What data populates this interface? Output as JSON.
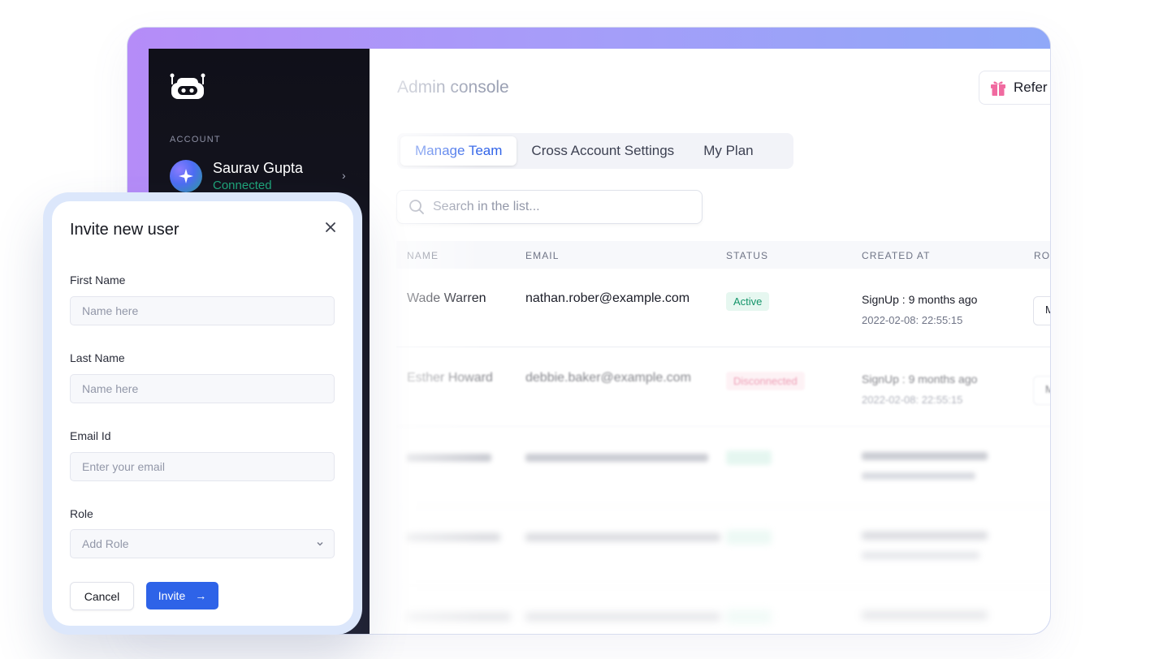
{
  "sidebar": {
    "account_label": "ACCOUNT",
    "user_name": "Saurav Gupta",
    "user_status": "Connected",
    "chevron": "›"
  },
  "header": {
    "title": "Admin console",
    "refer_label": "Refer"
  },
  "tabs": [
    {
      "label": "Manage Team",
      "active": true
    },
    {
      "label": "Cross Account Settings",
      "active": false
    },
    {
      "label": "My Plan",
      "active": false
    }
  ],
  "search": {
    "placeholder": "Search in the list..."
  },
  "table": {
    "columns": [
      "NAME",
      "EMAIL",
      "STATUS",
      "CREATED AT",
      "RO"
    ],
    "rows": [
      {
        "name": "Wade Warren",
        "email": "nathan.rober@example.com",
        "status": "Active",
        "created": "SignUp : 9 months ago",
        "date": "2022-02-08: 22:55:15",
        "role": "M"
      },
      {
        "name": "Esther Howard",
        "email": "debbie.baker@example.com",
        "status": "Disconnected",
        "created": "SignUp : 9 months ago",
        "date": "2022-02-08: 22:55:15",
        "role": "M"
      }
    ]
  },
  "modal": {
    "title": "Invite new user",
    "first_name_label": "First Name",
    "first_name_placeholder": "Name here",
    "last_name_label": "Last Name",
    "last_name_placeholder": "Name here",
    "email_label": "Email Id",
    "email_placeholder": "Enter your email",
    "role_label": "Role",
    "role_placeholder": "Add Role",
    "cancel_label": "Cancel",
    "invite_label": "Invite",
    "invite_arrow": "→"
  },
  "colors": {
    "accent": "#2e63e8",
    "active_status": "#139469",
    "disconnected_status": "#e0507a"
  }
}
